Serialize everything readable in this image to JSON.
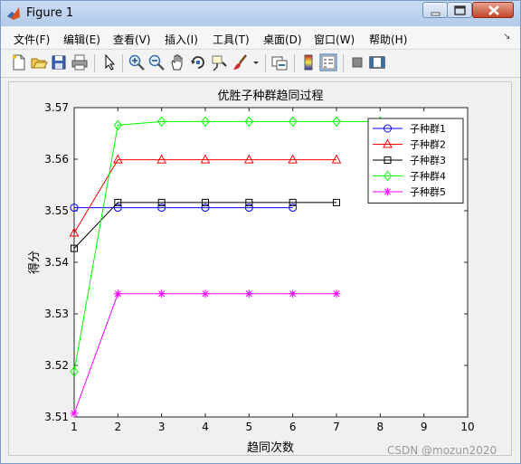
{
  "window": {
    "title": "Figure 1"
  },
  "menu": [
    {
      "name": "menu-file",
      "label": "文件(F)"
    },
    {
      "name": "menu-edit",
      "label": "编辑(E)"
    },
    {
      "name": "menu-view",
      "label": "查看(V)"
    },
    {
      "name": "menu-insert",
      "label": "插入(I)"
    },
    {
      "name": "menu-tools",
      "label": "工具(T)"
    },
    {
      "name": "menu-desktop",
      "label": "桌面(D)"
    },
    {
      "name": "menu-window",
      "label": "窗口(W)"
    },
    {
      "name": "menu-help",
      "label": "帮助(H)"
    }
  ],
  "menu_overflow": "↘",
  "toolbar": [
    "new-figure-icon",
    "open-file-icon",
    "save-icon",
    "print-icon",
    "edit-plot-arrow-icon",
    "zoom-in-icon",
    "zoom-out-icon",
    "pan-hand-icon",
    "rotate-3d-icon",
    "data-cursor-icon",
    "brush-icon",
    "link-plot-icon",
    "colorbar-icon",
    "legend-icon",
    "hide-plot-tools-icon",
    "show-plot-tools-icon"
  ],
  "chart_data": {
    "type": "line",
    "title": "优胜子种群趋同过程",
    "xlabel": "趋同次数",
    "ylabel": "得分",
    "xlim": [
      1,
      10
    ],
    "ylim": [
      3.51,
      3.57
    ],
    "xticks": [
      "1",
      "2",
      "3",
      "4",
      "5",
      "6",
      "7",
      "8",
      "9",
      "10"
    ],
    "yticks": [
      "3.51",
      "3.52",
      "3.53",
      "3.54",
      "3.55",
      "3.56",
      "3.57"
    ],
    "grid": false,
    "legend_position": "top-right",
    "series": [
      {
        "name": "子种群1",
        "color": "#0000ff",
        "marker": "circle",
        "x": [
          1,
          2,
          3,
          4,
          5,
          6
        ],
        "values": [
          3.5506,
          3.5506,
          3.5506,
          3.5506,
          3.5506,
          3.5506
        ]
      },
      {
        "name": "子种群2",
        "color": "#ff0000",
        "marker": "triangle",
        "x": [
          1,
          2,
          3,
          4,
          5,
          6,
          7
        ],
        "values": [
          3.5457,
          3.5599,
          3.5599,
          3.5599,
          3.5599,
          3.5599,
          3.5599
        ]
      },
      {
        "name": "子种群3",
        "color": "#000000",
        "marker": "square",
        "x": [
          1,
          2,
          3,
          4,
          5,
          6,
          7
        ],
        "values": [
          3.5427,
          3.5516,
          3.5516,
          3.5516,
          3.5516,
          3.5516,
          3.5516
        ]
      },
      {
        "name": "子种群4",
        "color": "#00ff00",
        "marker": "diamond",
        "x": [
          1,
          2,
          3,
          4,
          5,
          6,
          7,
          8
        ],
        "values": [
          3.5188,
          3.5666,
          3.5673,
          3.5673,
          3.5673,
          3.5673,
          3.5673,
          3.5673
        ]
      },
      {
        "name": "子种群5",
        "color": "#ff00ff",
        "marker": "star",
        "x": [
          1,
          2,
          3,
          4,
          5,
          6,
          7
        ],
        "values": [
          3.5107,
          3.5339,
          3.5339,
          3.5339,
          3.5339,
          3.5339,
          3.5339
        ]
      }
    ]
  },
  "watermark": "CSDN @mozun2020"
}
